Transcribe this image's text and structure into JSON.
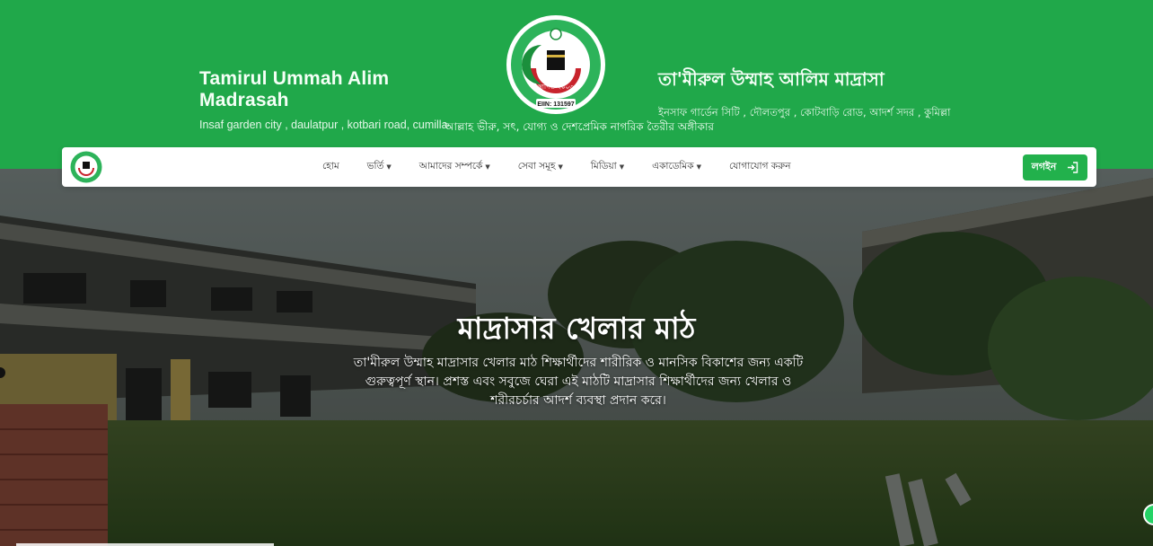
{
  "header": {
    "name_en": "Tamirul Ummah Alim Madrasah",
    "address_en": "Insaf garden city , daulatpur , kotbari road, cumilla",
    "name_bn": "তা'মীরুল উম্মাহ আলিম মাদ্রাসা",
    "address_bn": "ইনসাফ গার্ডেন সিটি , দৌলতপুর , কোটবাড়ি রোড, আদর্শ সদর , কুমিল্লা",
    "slogan": "আল্লাহ ভীরু, সৎ, যোগ্য ও দেশপ্রেমিক নাগরিক তৈরীর অঙ্গীকার",
    "seal": {
      "eiin": "EIIN: 131597",
      "established": "স্থাপিত-২০০৩"
    }
  },
  "nav": {
    "items": [
      {
        "label": "হোম",
        "dropdown": false
      },
      {
        "label": "ভর্তি",
        "dropdown": true
      },
      {
        "label": "আমাদের সম্পর্কে",
        "dropdown": true
      },
      {
        "label": "সেবা সমূহ",
        "dropdown": true
      },
      {
        "label": "মিডিয়া",
        "dropdown": true
      },
      {
        "label": "একাডেমিক",
        "dropdown": true
      },
      {
        "label": "যোগাযোগ করুন",
        "dropdown": false
      }
    ],
    "login_label": "লগইন"
  },
  "hero": {
    "title": "মাদ্রাসার খেলার মাঠ",
    "description": "তা'মীরুল উম্মাহ মাদ্রাসার খেলার মাঠ শিক্ষার্থীদের শারীরিক ও মানসিক বিকাশের জন্য একটি গুরুত্বপূর্ণ স্থান। প্রশস্ত এবং সবুজে ঘেরা এই মাঠটি মাদ্রাসার শিক্ষার্থীদের জন্য খেলার ও শরীরচর্চার আদর্শ ব্যবস্থা প্রদান করে।"
  },
  "colors": {
    "brand_green": "#20a84a",
    "button_green": "#22b14c",
    "seal_red": "#c8232c"
  },
  "icons": {
    "login": "login-arrow-icon",
    "chat": "whatsapp-icon",
    "caret": "caret-down-icon"
  }
}
